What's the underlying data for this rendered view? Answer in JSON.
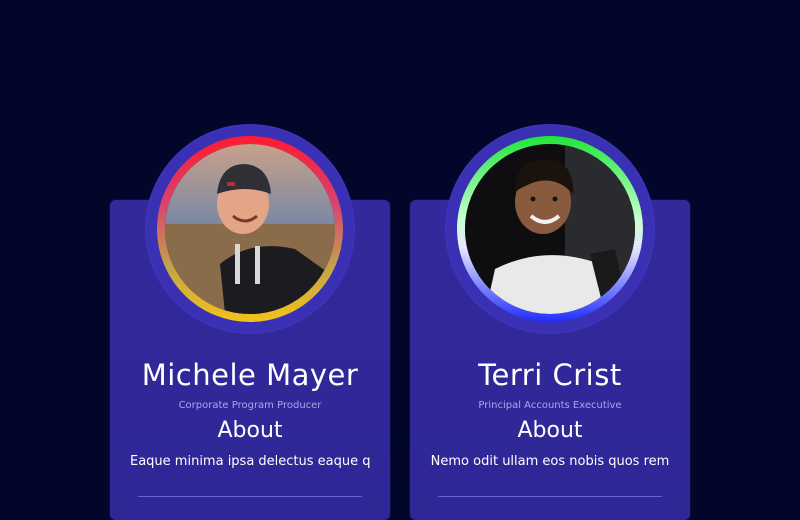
{
  "cards": [
    {
      "name": "Michele Mayer",
      "role": "Corporate Program Producer",
      "about_heading": "About",
      "about_text": "Eaque minima ipsa delectus eaque qu",
      "ring_colors": [
        "#ff1b2e",
        "#f2c21a"
      ]
    },
    {
      "name": "Terri Crist",
      "role": "Principal Accounts Executive",
      "about_heading": "About",
      "about_text": "Nemo odit ullam eos nobis quos rem",
      "ring_colors": [
        "#1fe63a",
        "#1f2cff"
      ]
    }
  ]
}
